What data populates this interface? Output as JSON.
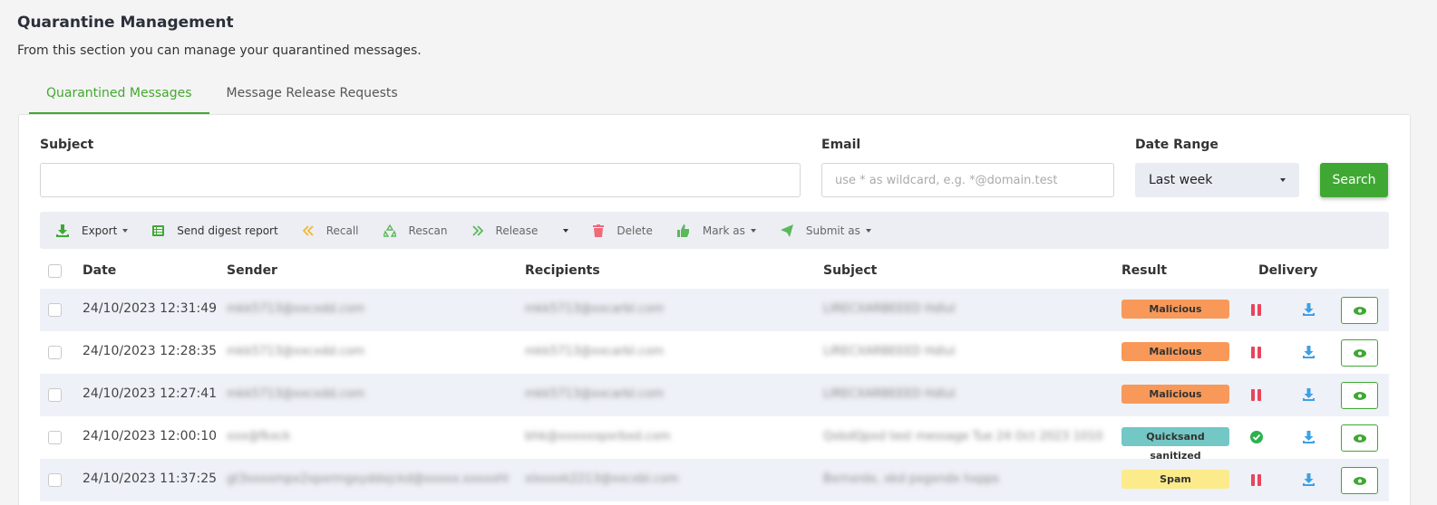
{
  "page": {
    "title": "Quarantine Management",
    "subtitle": "From this section you can manage your quarantined messages."
  },
  "tabs": [
    {
      "label": "Quarantined Messages",
      "active": true
    },
    {
      "label": "Message Release Requests",
      "active": false
    }
  ],
  "filters": {
    "subject_label": "Subject",
    "subject_value": "",
    "email_label": "Email",
    "email_placeholder": "use * as wildcard, e.g. *@domain.test",
    "date_range_label": "Date Range",
    "date_range_value": "Last week",
    "search_label": "Search"
  },
  "toolbar": {
    "export": "Export",
    "send_digest": "Send digest report",
    "recall": "Recall",
    "rescan": "Rescan",
    "release": "Release",
    "delete": "Delete",
    "mark_as": "Mark as",
    "submit_as": "Submit as"
  },
  "table": {
    "headers": [
      "Date",
      "Sender",
      "Recipients",
      "Subject",
      "Result",
      "Delivery"
    ],
    "rows": [
      {
        "date": "24/10/2023 12:31:49",
        "sender": "mkk5713@xxcxdd.com",
        "recipients": "mkk5713@xxcarbl.com",
        "subject": "LIRECXARBEEED Hdlul",
        "result": "Malicious",
        "delivery": "paused"
      },
      {
        "date": "24/10/2023 12:28:35",
        "sender": "mkk5713@xxcxdd.com",
        "recipients": "mkk5713@xxcarbl.com",
        "subject": "LIRECXARBEEED Hdlul",
        "result": "Malicious",
        "delivery": "paused"
      },
      {
        "date": "24/10/2023 12:27:41",
        "sender": "mkk5713@xxcxdd.com",
        "recipients": "mkk5713@xxcarbl.com",
        "subject": "LIRECXARBEEED Hdlul",
        "result": "Malicious",
        "delivery": "paused"
      },
      {
        "date": "24/10/2023 12:00:10",
        "sender": "xxx@fkxck",
        "recipients": "bhk@xxxxxxpxrbxd.com",
        "subject": "QxbdQpxd test message Tue 24 Oct 2023 1010...",
        "result": "Quicksand sanitized",
        "delivery": "delivered"
      },
      {
        "date": "24/10/2023 11:37:25",
        "sender": "gt3xxxxmpx2xpxrmgxyddxjckd@xxxxx.xxxxxhtn...",
        "recipients": "xlxxxxk2213@xxcxbl.com",
        "subject": "Bxrnxrdx, xkd pxgxndx hxpps",
        "result": "Spam",
        "delivery": "paused"
      }
    ]
  },
  "colors": {
    "accent": "#3fa833",
    "malicious": "#f89959",
    "sanitized": "#73c7c4",
    "spam": "#fbeb8b",
    "pause": "#e8445a",
    "download": "#3ea0e4"
  }
}
